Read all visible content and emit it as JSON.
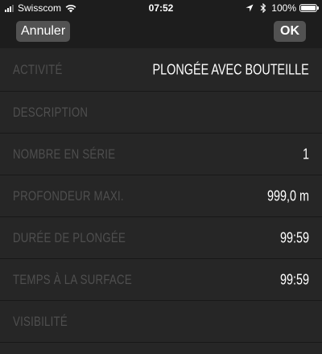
{
  "status_bar": {
    "carrier": "Swisscom",
    "time": "07:52",
    "battery": "100%",
    "icons": [
      "signal-icon",
      "wifi-icon",
      "location-arrow-icon",
      "bluetooth-icon",
      "battery-icon"
    ]
  },
  "nav": {
    "cancel_label": "Annuler",
    "ok_label": "OK"
  },
  "form": {
    "rows": [
      {
        "label": "ACTIVITÉ",
        "value": "PLONGÉE AVEC BOUTEILLE"
      },
      {
        "label": "DESCRIPTION",
        "value": ""
      },
      {
        "label": "NOMBRE EN SÉRIE",
        "value": "1"
      },
      {
        "label": "PROFONDEUR MAXI.",
        "value": "999,0 m"
      },
      {
        "label": "DURÉE DE PLONGÉE",
        "value": "99:59"
      },
      {
        "label": "TEMPS À LA SURFACE",
        "value": "99:59"
      },
      {
        "label": "VISIBILITÉ",
        "value": ""
      }
    ]
  },
  "colors": {
    "background": "#262626",
    "bar_background": "#1d1d1d",
    "button_background": "#525252",
    "label": "#4f4f4f",
    "value": "#ffffff"
  }
}
